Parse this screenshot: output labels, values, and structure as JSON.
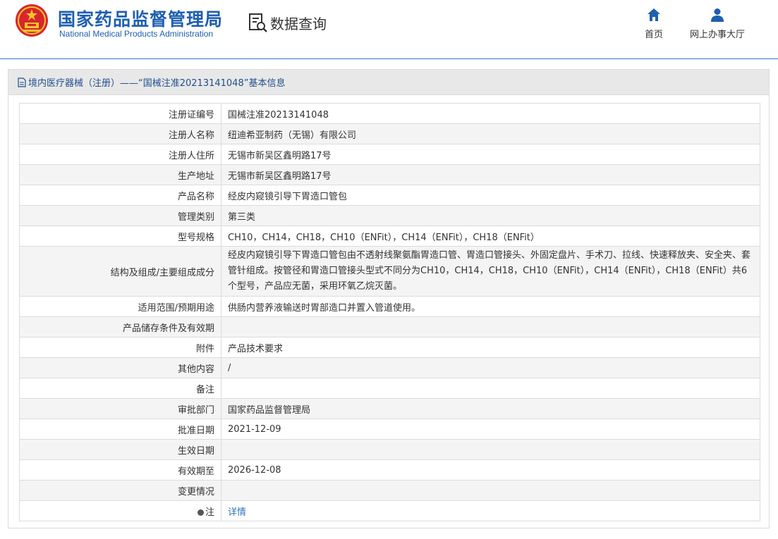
{
  "header": {
    "brand_cn": "国家药品监督管理局",
    "brand_en": "National Medical Products Administration",
    "query_label": "数据查询",
    "nav": {
      "home": "首页",
      "online": "网上办事大厅"
    },
    "colors": {
      "brand": "#1f5fb0",
      "accent": "#2f74c0",
      "emblem": "#d8262c"
    }
  },
  "panel": {
    "title": "境内医疗器械（注册）——“国械注准20213141048”基本信息"
  },
  "rows": [
    {
      "k": "注册证编号",
      "v": "国械注准20213141048"
    },
    {
      "k": "注册人名称",
      "v": "纽迪希亚制药（无锡）有限公司"
    },
    {
      "k": "注册人住所",
      "v": "无锡市新吴区鑫明路17号"
    },
    {
      "k": "生产地址",
      "v": "无锡市新吴区鑫明路17号"
    },
    {
      "k": "产品名称",
      "v": "经皮内窥镜引导下胃造口管包"
    },
    {
      "k": "管理类别",
      "v": "第三类"
    },
    {
      "k": "型号规格",
      "v": "CH10，CH14，CH18，CH10（ENFit），CH14（ENFit），CH18（ENFit）"
    },
    {
      "k": "结构及组成/主要组成成分",
      "v": "经皮内窥镜引导下胃造口管包由不透射线聚氨酯胃造口管、胃造口管接头、外固定盘片、手术刀、拉线、快速释放夹、安全夹、套管针组成。按管径和胃造口管接头型式不同分为CH10，CH14，CH18，CH10（ENFit），CH14（ENFit），CH18（ENFit）共6个型号，产品应无菌，采用环氧乙烷灭菌。"
    },
    {
      "k": "适用范围/预期用途",
      "v": "供肠内营养液输送时胃部造口并置入管道使用。"
    },
    {
      "k": "产品储存条件及有效期",
      "v": ""
    },
    {
      "k": "附件",
      "v": "产品技术要求"
    },
    {
      "k": "其他内容",
      "v": "/"
    },
    {
      "k": "备注",
      "v": ""
    },
    {
      "k": "审批部门",
      "v": "国家药品监督管理局"
    },
    {
      "k": "批准日期",
      "v": "2021-12-09"
    },
    {
      "k": "生效日期",
      "v": ""
    },
    {
      "k": "有效期至",
      "v": "2026-12-08"
    },
    {
      "k": "变更情况",
      "v": ""
    },
    {
      "k": "注",
      "v": "详情"
    }
  ]
}
